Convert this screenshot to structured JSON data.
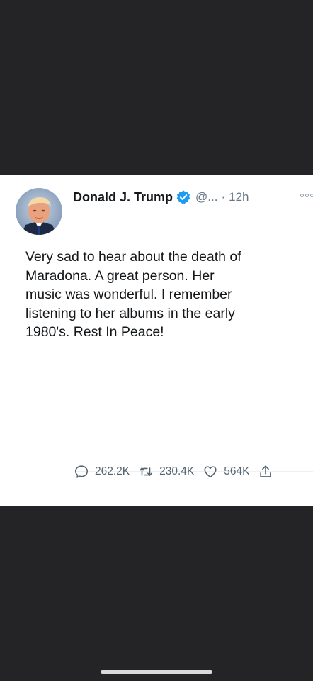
{
  "tweet": {
    "author_name": "Donald J. Trump",
    "handle": "@...",
    "separator": "·",
    "time_ago": "12h",
    "text": "Very sad to hear about the death of\nMaradona. A great person. Her\nmusic was wonderful. I remember\nlistening to her albums in the early\n1980's. Rest In Peace!",
    "verified": true,
    "colors": {
      "verified_badge": "#1d9bf0",
      "name": "#14171a",
      "meta": "#657786"
    }
  },
  "stats": {
    "replies": "262.2K",
    "retweets": "230.4K",
    "likes": "564K"
  },
  "icons": {
    "reply": "speech-bubble-icon",
    "retweet": "retweet-arrows-icon",
    "like": "heart-icon",
    "share": "share-upload-icon",
    "more": "more-dots-icon",
    "verified": "verified-check-icon"
  }
}
